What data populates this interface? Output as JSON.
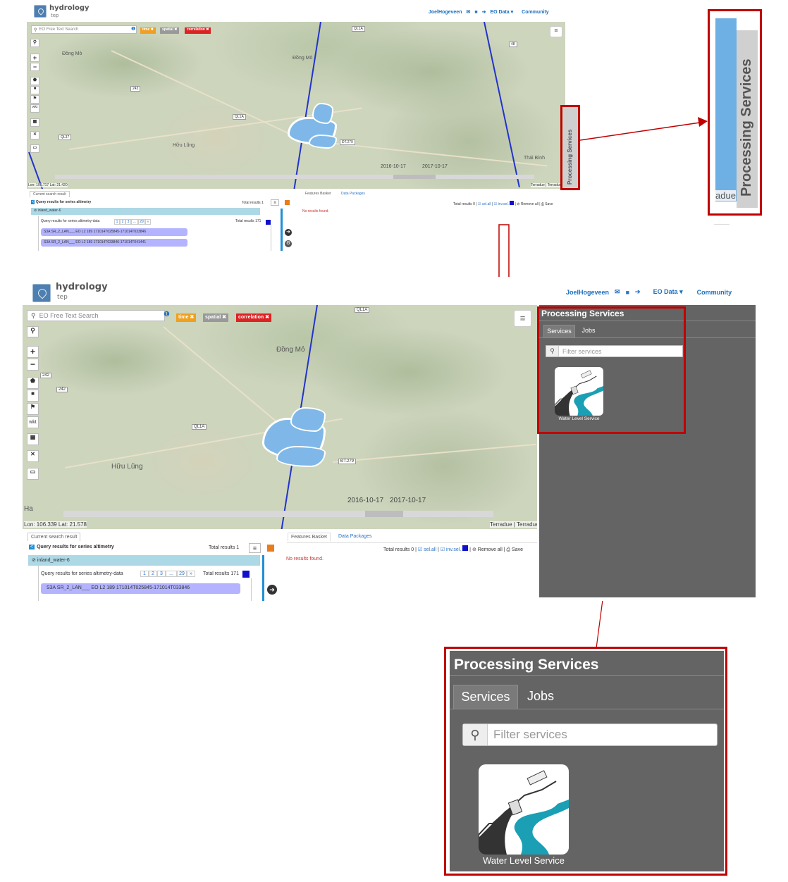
{
  "header": {
    "logo_title": "hydrology",
    "logo_sub": "tep",
    "user": "JoelHogeveen",
    "eo_data": "EO Data",
    "community": "Community"
  },
  "toolbar": {
    "search_placeholder": "EO Free Text Search",
    "tag_time": "time ✖",
    "tag_spatial": "spatial ✖",
    "tag_correlation": "correlation ✖",
    "draw_wkt": "wkt"
  },
  "map": {
    "places": {
      "dong_mo": "Đồng Mỏ",
      "huu_lung": "Hữu Lũng",
      "thai_binh": "Thái Bình",
      "ha": "Ha"
    },
    "shields": {
      "ql1a": "QL1A",
      "r242": "242",
      "r243": "243",
      "dt279": "ĐT.279",
      "ql37": "QL37",
      "r48": "48",
      "r247": "247"
    },
    "date_start": "2016-10-17",
    "date_end": "2017-10-17",
    "coord_top": "Lon: 106.717 Lat: 21.420",
    "coord_mid": "Lon: 106.339 Lat: 21.578",
    "attribution": "Terradue | Terradue",
    "processing_tab": "Processing Services"
  },
  "results": {
    "tab_current": "Current search result",
    "query_series": "Query results for series altimetry",
    "total_1": "Total results 1",
    "inland": "inland_water-6",
    "query_data": "Query results for series altimetry-data",
    "total_171": "Total results 171",
    "pages": [
      "1",
      "2",
      "3",
      "...",
      "29",
      "»"
    ],
    "row1": "S3A SR_2_LAN___ EO L2 189 171014T025845-171014T033846",
    "row2": "S3A SR_2_LAN___ EO L2 189 171014T033846-171014T041441"
  },
  "basket": {
    "tab_features": "Features Basket",
    "tab_packages": "Data Packages",
    "total_0": "Total results 0",
    "select_all": "sel.all",
    "invert": "inv.sel.",
    "remove_all": "Remove all",
    "save": "Save",
    "no_results": "No results found."
  },
  "processing": {
    "title": "Processing Services",
    "tab_services": "Services",
    "tab_jobs": "Jobs",
    "filter_placeholder": "Filter services",
    "service_name": "Water Level Service"
  },
  "zoom_crop": {
    "label": "Processing Services",
    "partial": "adue"
  },
  "colors": {
    "highlight": "#c00000",
    "panel": "#646464",
    "accent": "#1f8fd6"
  }
}
